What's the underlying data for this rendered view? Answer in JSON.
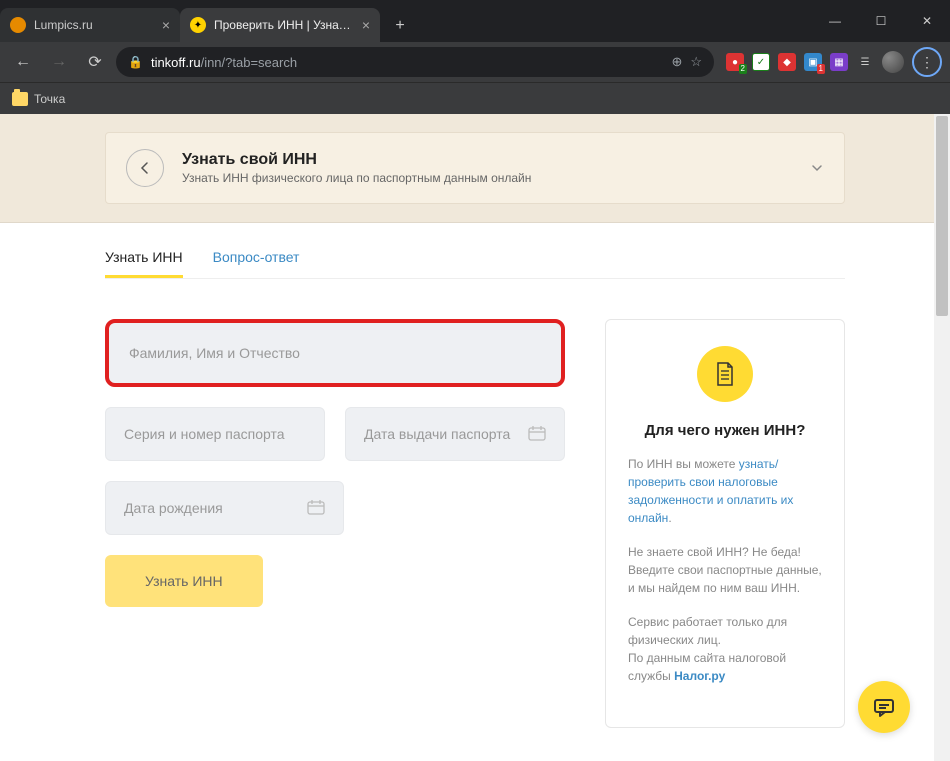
{
  "browser": {
    "tabs": [
      {
        "title": "Lumpics.ru"
      },
      {
        "title": "Проверить ИНН | Узнать свой И"
      }
    ],
    "url_host": "tinkoff.ru",
    "url_path": "/inn/?tab=search",
    "bookmark": "Точка"
  },
  "hero": {
    "title": "Узнать свой ИНН",
    "subtitle": "Узнать ИНН физического лица по паспортным данным онлайн"
  },
  "tabsnav": {
    "active": "Узнать ИНН",
    "secondary": "Вопрос-ответ"
  },
  "form": {
    "fio_placeholder": "Фамилия, Имя и Отчество",
    "passport_placeholder": "Серия и номер паспорта",
    "issue_date_placeholder": "Дата выдачи паспорта",
    "birth_placeholder": "Дата рождения",
    "submit_label": "Узнать ИНН"
  },
  "side": {
    "heading": "Для чего нужен ИНН?",
    "p1_prefix": "По ИНН вы можете ",
    "p1_link": "узнать/ проверить свои налоговые задолженности и оплатить их онлайн",
    "p1_suffix": ".",
    "p2": "Не знаете свой ИНН? Не беда! Введите свои паспортные данные, и мы найдем по ним ваш ИНН.",
    "p3_prefix": "Сервис работает только для физических лиц.\nПо данным сайта налоговой службы ",
    "p3_link": "Налог.ру"
  }
}
